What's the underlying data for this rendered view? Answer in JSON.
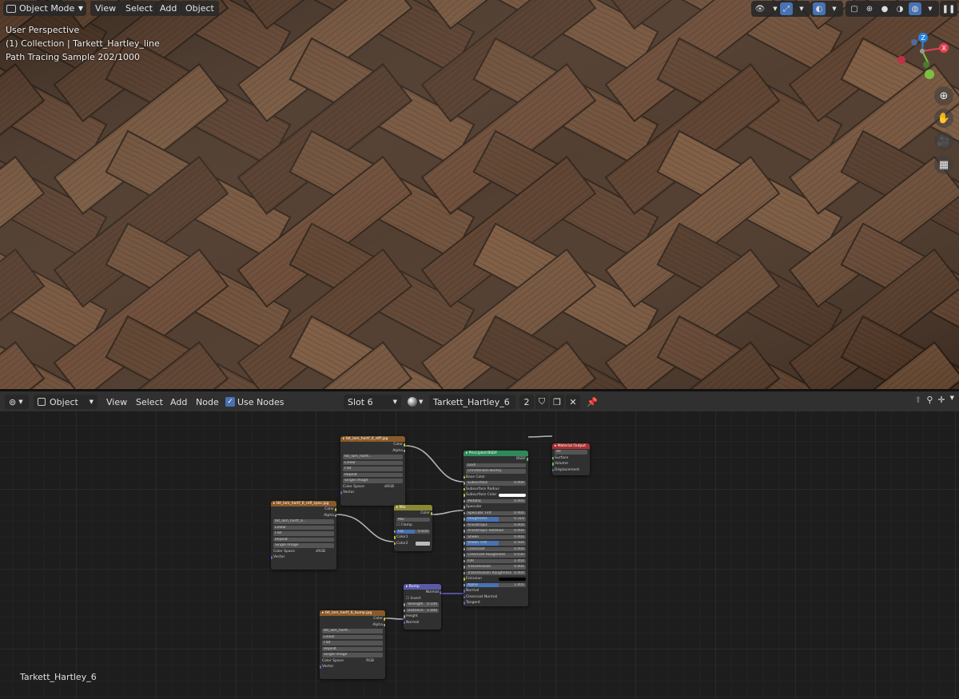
{
  "viewport": {
    "mode_label": "Object Mode",
    "menu": [
      "View",
      "Select",
      "Add",
      "Object"
    ],
    "overlay_lines": [
      "User Perspective",
      "(1) Collection | Tarkett_Hartley_line",
      "Path Tracing Sample 202/1000"
    ],
    "gizmo_axes": [
      "X",
      "Y",
      "Z"
    ],
    "nav_icons": [
      "zoom-icon",
      "hand-icon",
      "camera-icon",
      "grid-icon"
    ],
    "icons": {
      "zoom": "⊕",
      "hand": "✋",
      "camera": "🎥",
      "grid": "▦"
    }
  },
  "node_editor": {
    "context_label": "Object",
    "menu": [
      "View",
      "Select",
      "Add",
      "Node"
    ],
    "use_nodes_label": "Use Nodes",
    "slot_label": "Slot 6",
    "material_name": "Tarkett_Hartley_6",
    "user_count": "2",
    "footer_material": "Tarkett_Hartley_6"
  },
  "nodes": {
    "tex1": {
      "title": "▸ tkt_lam_hartf_6_diff.jpg",
      "out": [
        "Color",
        "Alpha"
      ],
      "file": "tkt_lam_hartf...",
      "rows": [
        "Linear",
        "Flat",
        "Repeat",
        "Single Image"
      ],
      "cs_label": "Color Space",
      "cs_val": "sRGB",
      "vector": "Vector"
    },
    "tex2": {
      "title": "▸ tkt_lam_hartf_6_refl_spec.jpg",
      "out": [
        "Color",
        "Alpha"
      ],
      "file": "tkt_lam_hartf_6...",
      "rows": [
        "Linear",
        "Flat",
        "Repeat",
        "Single Image"
      ],
      "cs_label": "Color Space",
      "cs_val": "sRGB",
      "vector": "Vector"
    },
    "tex3": {
      "title": "▸ tkt_lam_hartf_6_bump.jpg",
      "out": [
        "Color",
        "Alpha"
      ],
      "file": "tkt_lam_hartf...",
      "rows": [
        "Linear",
        "Flat",
        "Repeat",
        "Single Image"
      ],
      "cs_label": "Color Space",
      "cs_val": "RGB",
      "vector": "Vector"
    },
    "mix": {
      "title": "▸ Mix",
      "out": "Color",
      "mode": "Mix",
      "clamp": "Clamp",
      "fac": "Fac",
      "fac_val": "0.650",
      "c1": "Color1",
      "c2": "Color2"
    },
    "bump": {
      "title": "▸ Bump",
      "out": "Normal",
      "invert": "Invert",
      "strength": "Strength",
      "strength_val": "0.100",
      "distance": "Distance",
      "distance_val": "1.000",
      "height": "Height",
      "normal": "Normal"
    },
    "bsdf": {
      "title": "▸ Principled BSDF",
      "out": "BSDF",
      "dist": "GGX",
      "ss": "Christensen-Burley",
      "inputs": [
        [
          "Base Color",
          ""
        ],
        [
          "Subsurface",
          "0.000"
        ],
        [
          "Subsurface Radius",
          ""
        ],
        [
          "Subsurface Color",
          ""
        ],
        [
          "Metallic",
          "0.000"
        ],
        [
          "Specular",
          ""
        ],
        [
          "Specular Tint",
          "0.000"
        ],
        [
          "Roughness",
          "0.310"
        ],
        [
          "Anisotropic",
          "0.000"
        ],
        [
          "Anisotropic Rotation",
          "0.000"
        ],
        [
          "Sheen",
          "0.000"
        ],
        [
          "Sheen Tint",
          "0.500"
        ],
        [
          "Clearcoat",
          "0.000"
        ],
        [
          "Clearcoat Roughness",
          "0.030"
        ],
        [
          "IOR",
          "1.450"
        ],
        [
          "Transmission",
          "0.000"
        ],
        [
          "Transmission Roughness",
          "0.000"
        ],
        [
          "Emission",
          ""
        ],
        [
          "Alpha",
          "1.000"
        ],
        [
          "Normal",
          ""
        ],
        [
          "Clearcoat Normal",
          ""
        ],
        [
          "Tangent",
          ""
        ]
      ]
    },
    "output": {
      "title": "▸ Material Output",
      "target": "All",
      "inputs": [
        "Surface",
        "Volume",
        "Displacement"
      ]
    }
  }
}
